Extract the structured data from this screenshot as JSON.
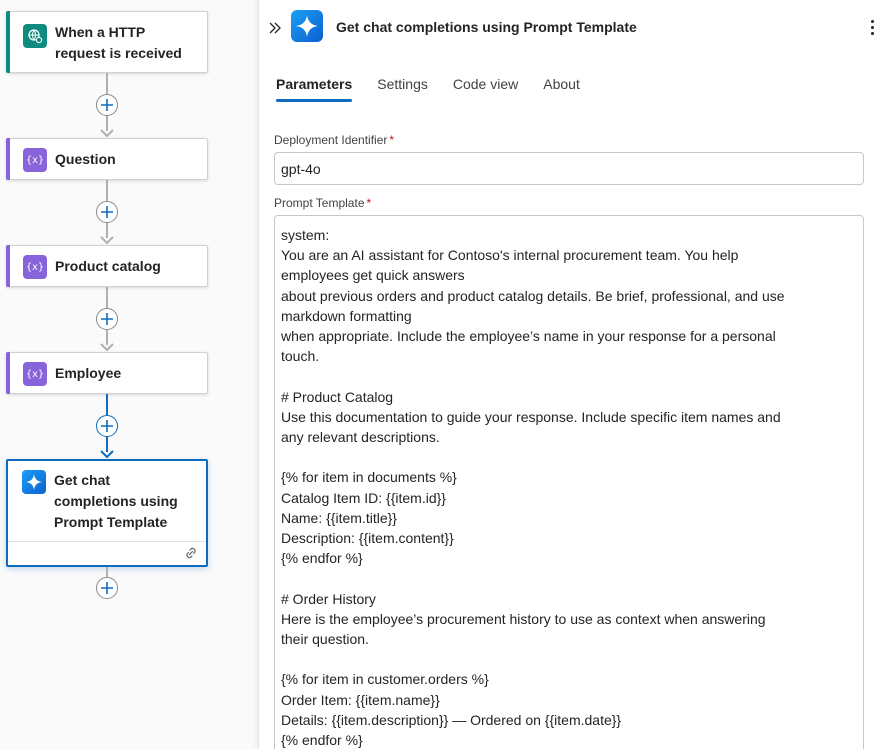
{
  "colors": {
    "trigger_accent": "#0f8a7e",
    "variable_accent": "#8764d9",
    "ai_icon_gradient_start": "#1aa0f5",
    "ai_icon_gradient_end": "#0b5fd0",
    "selection_blue": "#0f6cbd"
  },
  "canvas": {
    "nodes": [
      {
        "title": "When a HTTP request is received",
        "icon": "http-request-icon",
        "kind": "trigger"
      },
      {
        "title": "Question",
        "icon": "variable-icon",
        "kind": "variable"
      },
      {
        "title": "Product catalog",
        "icon": "variable-icon",
        "kind": "variable"
      },
      {
        "title": "Employee",
        "icon": "variable-icon",
        "kind": "variable"
      },
      {
        "title": "Get chat completions using Prompt Template",
        "icon": "ai-sparkle-icon",
        "kind": "ai",
        "selected": true
      }
    ]
  },
  "panel": {
    "title": "Get chat completions using Prompt Template",
    "tabs": [
      {
        "label": "Parameters",
        "active": true
      },
      {
        "label": "Settings",
        "active": false
      },
      {
        "label": "Code view",
        "active": false
      },
      {
        "label": "About",
        "active": false
      }
    ],
    "deployment": {
      "label": "Deployment Identifier",
      "required_mark": "*",
      "value": "gpt-4o"
    },
    "prompt": {
      "label": "Prompt Template",
      "required_mark": "*",
      "value": "system:\nYou are an AI assistant for Contoso's internal procurement team. You help\nemployees get quick answers\nabout previous orders and product catalog details. Be brief, professional, and use\nmarkdown formatting\nwhen appropriate. Include the employee’s name in your response for a personal\ntouch.\n\n# Product Catalog\nUse this documentation to guide your response. Include specific item names and\nany relevant descriptions.\n\n{% for item in documents %}\nCatalog Item ID: {{item.id}}\nName: {{item.title}}\nDescription: {{item.content}}\n{% endfor %}\n\n# Order History\nHere is the employee’s procurement history to use as context when answering\ntheir question.\n\n{% for item in customer.orders %}\nOrder Item: {{item.name}}\nDetails: {{item.description}} — Ordered on {{item.date}}\n{% endfor %}"
    }
  }
}
